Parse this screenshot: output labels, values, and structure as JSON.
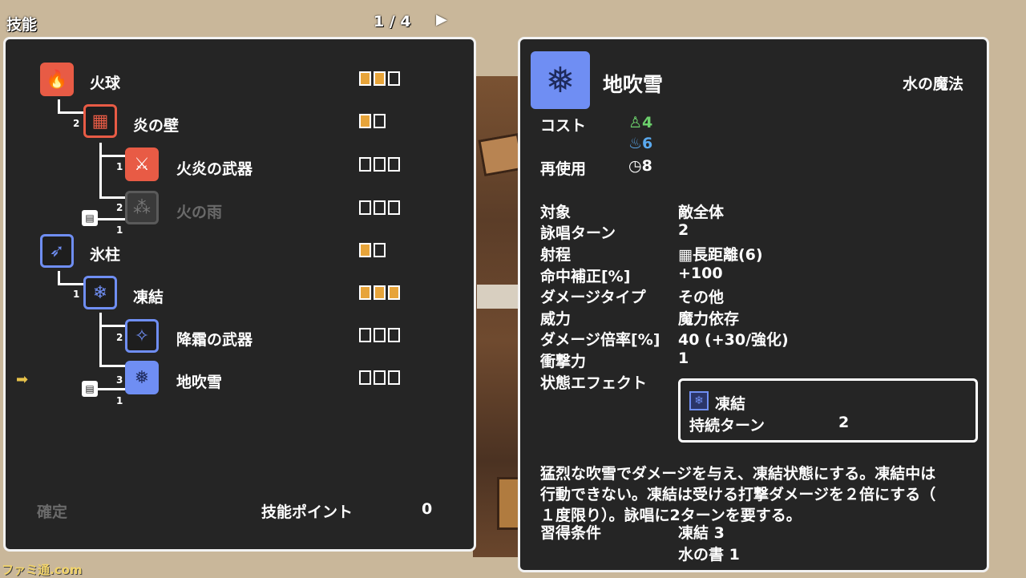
{
  "header": {
    "title": "技能",
    "page": "1 / 4",
    "next_icon": "play-arrow-icon"
  },
  "tree": {
    "nodes": [
      {
        "name": "火球",
        "icon": "fire-icon",
        "pips": [
          1,
          1,
          0
        ]
      },
      {
        "name": "炎の壁",
        "icon": "fire-wall-icon",
        "req": "2",
        "pips": [
          1,
          0
        ]
      },
      {
        "name": "火炎の武器",
        "icon": "fire-weapon-icon",
        "req": "1",
        "pips": [
          0,
          0,
          0
        ]
      },
      {
        "name": "火の雨",
        "icon": "fire-rain-icon",
        "req": "2",
        "book_req": "1",
        "pips": [
          0,
          0,
          0
        ]
      },
      {
        "name": "氷柱",
        "icon": "icicle-icon",
        "pips": [
          1,
          0
        ]
      },
      {
        "name": "凍結",
        "icon": "snowflake-icon",
        "req": "1",
        "pips": [
          1,
          1,
          1
        ]
      },
      {
        "name": "降霜の武器",
        "icon": "frost-weapon-icon",
        "req": "2",
        "pips": [
          0,
          0,
          0
        ]
      },
      {
        "name": "地吹雪",
        "icon": "blizzard-icon",
        "req": "3",
        "book_req": "1",
        "pips": [
          0,
          0,
          0
        ]
      }
    ]
  },
  "footer": {
    "confirm": "確定",
    "skill_points_label": "技能ポイント",
    "skill_points_value": "0"
  },
  "detail": {
    "name": "地吹雪",
    "school": "水の魔法",
    "cost_label": "コスト",
    "cost_stamina": "4",
    "cost_mana": "6",
    "cooldown_label": "再使用",
    "cooldown": "8",
    "stats": [
      {
        "label": "対象",
        "value": "敵全体"
      },
      {
        "label": "詠唱ターン",
        "value": "2"
      },
      {
        "label": "射程",
        "value": "長距離(6)"
      },
      {
        "label": "命中補正[%]",
        "value": "+100"
      },
      {
        "label": "ダメージタイプ",
        "value": "その他"
      },
      {
        "label": "威力",
        "value": "魔力依存"
      },
      {
        "label": "ダメージ倍率[%]",
        "value": "40 (+30/強化)"
      },
      {
        "label": "衝撃力",
        "value": "1"
      },
      {
        "label": "状態エフェクト",
        "value": ""
      }
    ],
    "effect": {
      "name": "凍結",
      "duration_label": "持続ターン",
      "duration": "2"
    },
    "description_lines": [
      "猛烈な吹雪でダメージを与え、凍結状態にする。凍結中は",
      "行動できない。凍結は受ける打撃ダメージを２倍にする（",
      "１度限り）。詠唱に2ターンを要する。"
    ],
    "learn_label": "習得条件",
    "learn_reqs": [
      "凍結 3",
      "水の書 1"
    ]
  },
  "watermark": "ファミ通.com"
}
